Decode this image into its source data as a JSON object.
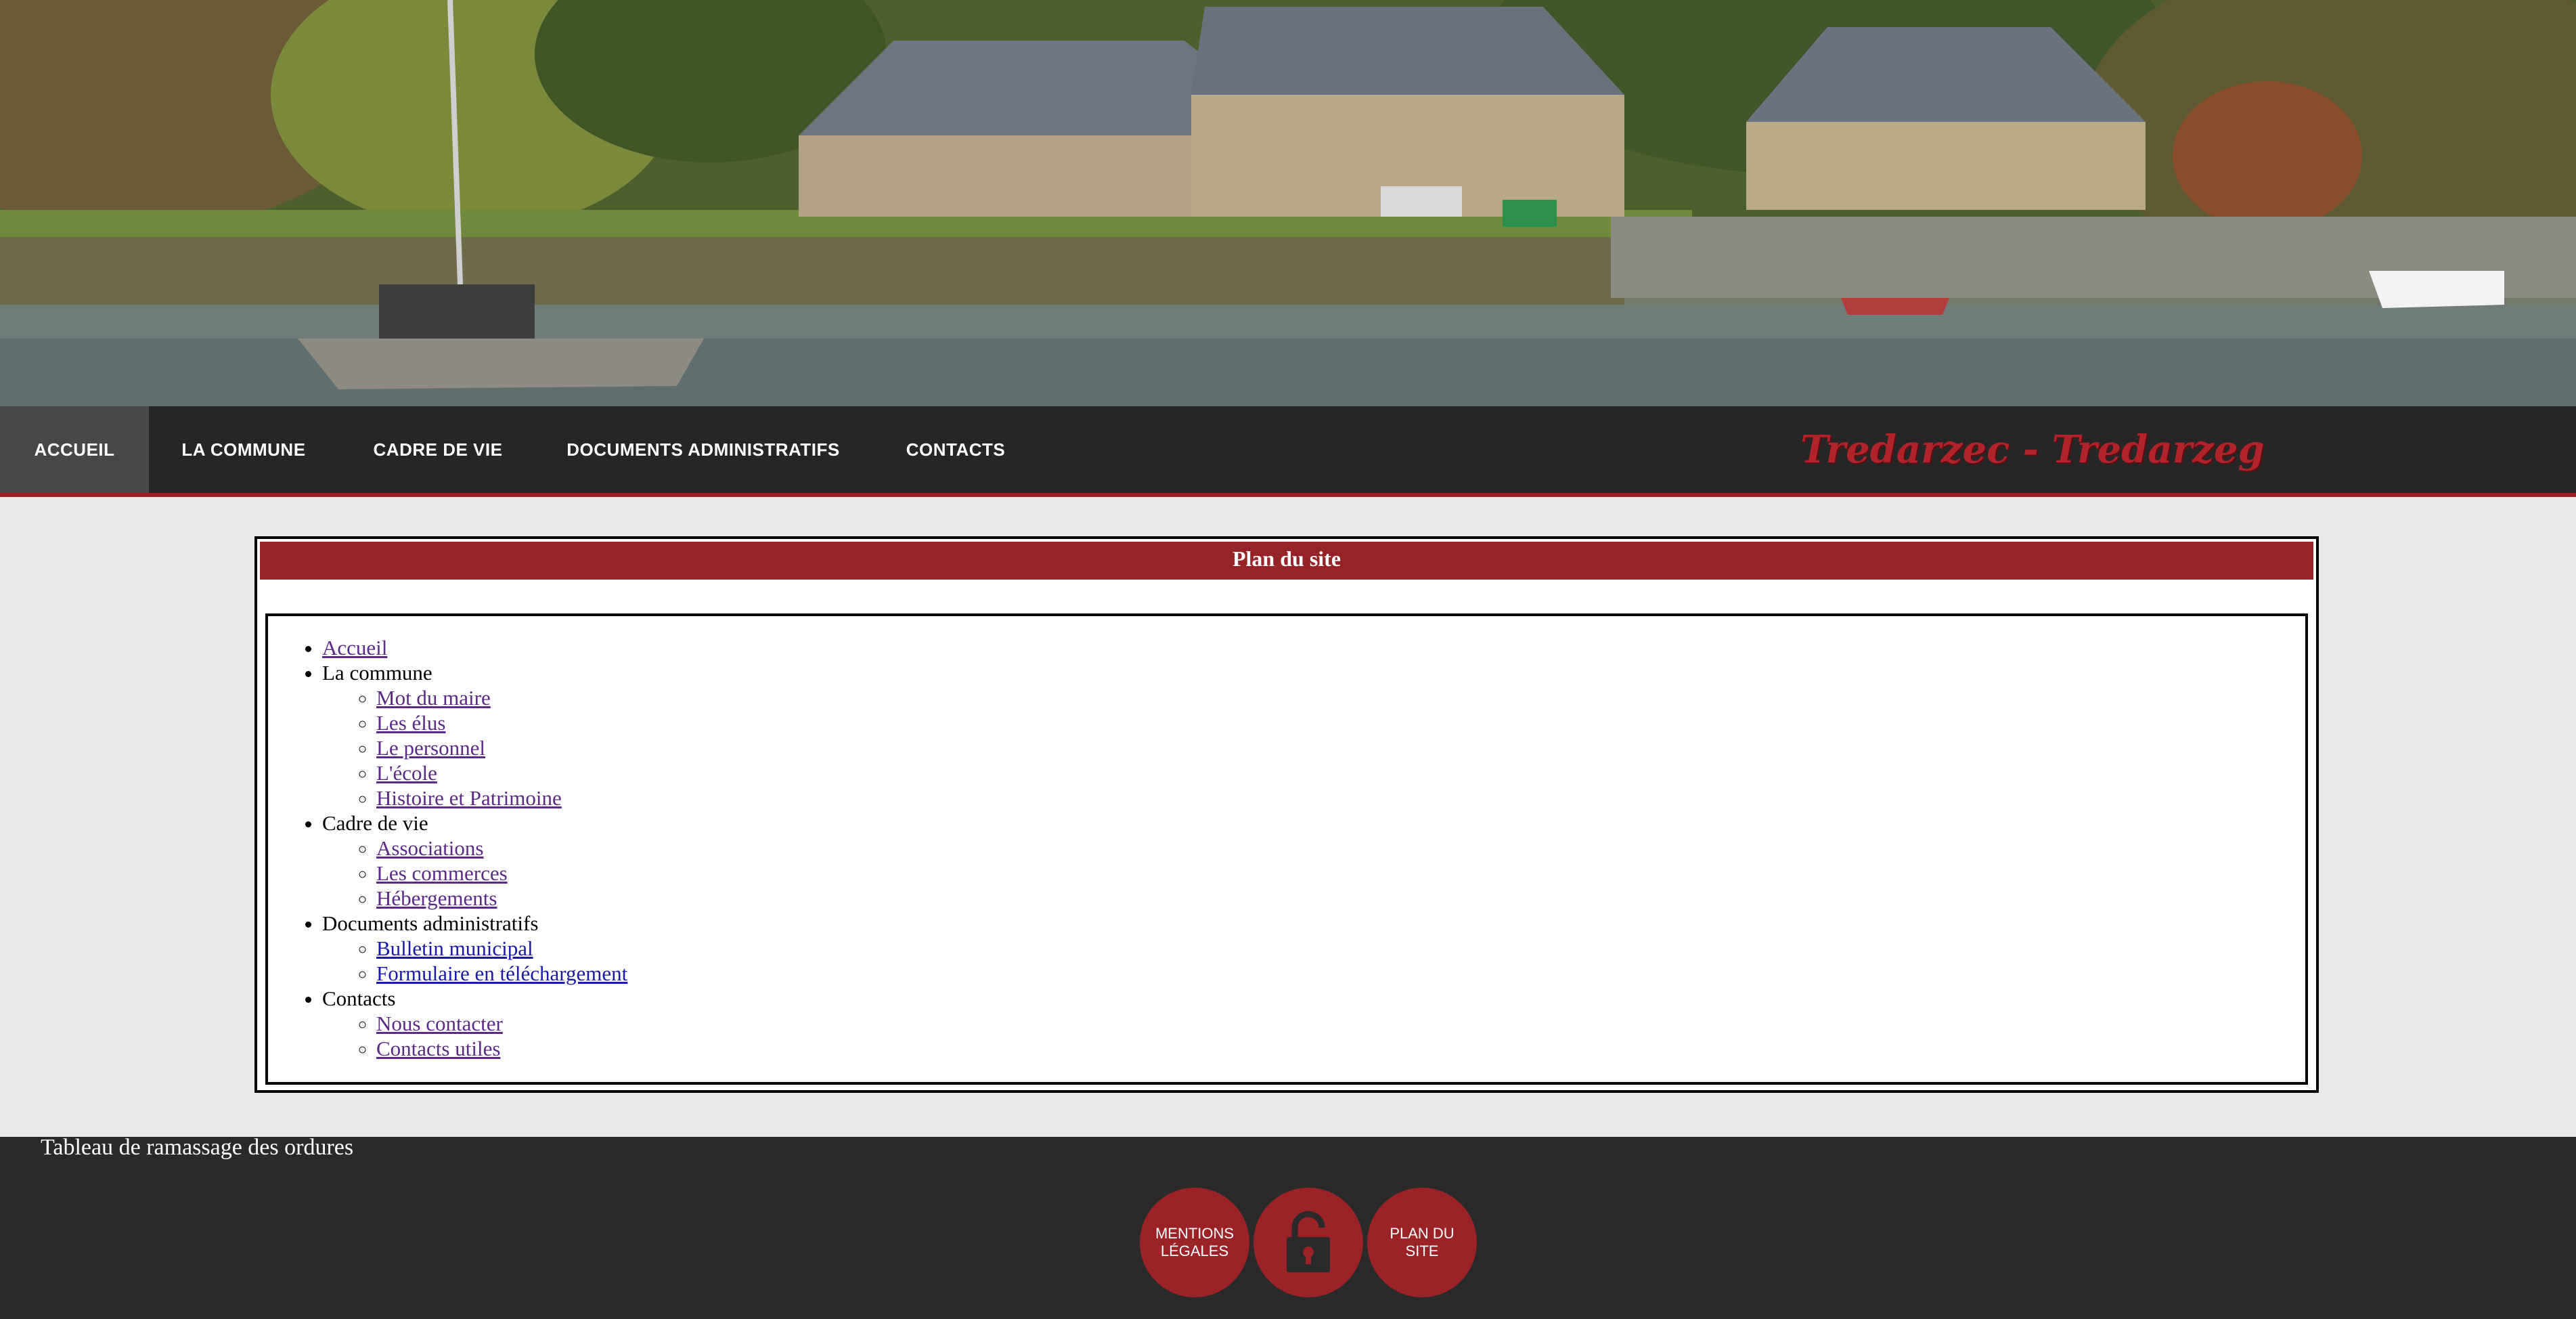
{
  "nav": {
    "items": [
      {
        "label": "ACCUEIL",
        "active": true
      },
      {
        "label": "LA COMMUNE",
        "active": false
      },
      {
        "label": "CADRE DE VIE",
        "active": false
      },
      {
        "label": "DOCUMENTS ADMINISTRATIFS",
        "active": false
      },
      {
        "label": "CONTACTS",
        "active": false
      }
    ],
    "site_title": "Tredarzec - Tredarzeg"
  },
  "sitemap": {
    "title": "Plan du site",
    "sections": [
      {
        "label": "Accueil",
        "is_link": true,
        "children": []
      },
      {
        "label": "La commune",
        "is_link": false,
        "children": [
          "Mot du maire",
          "Les élus",
          "Le personnel",
          "L'école",
          "Histoire et Patrimoine"
        ]
      },
      {
        "label": "Cadre de vie",
        "is_link": false,
        "children": [
          "Associations",
          "Les commerces",
          "Hébergements"
        ]
      },
      {
        "label": "Documents administratifs",
        "is_link": false,
        "children": [
          "Bulletin municipal",
          "Formulaire en téléchargement"
        ]
      },
      {
        "label": "Contacts",
        "is_link": false,
        "children": [
          "Nous contacter",
          "Contacts utiles"
        ]
      }
    ]
  },
  "footer": {
    "text": "Tableau de ramassage des ordures",
    "buttons": {
      "mentions_line1": "MENTIONS",
      "mentions_line2": "LÉGALES",
      "plan_line1": "PLAN DU",
      "plan_line2": "SITE"
    }
  },
  "colors": {
    "accent_red": "#9b2226",
    "nav_bg": "#262626",
    "link_visited": "#5b2a86",
    "link": "#1a1aa6"
  },
  "icons": {
    "hero": "harbor-photo",
    "lock": "lock-icon"
  }
}
